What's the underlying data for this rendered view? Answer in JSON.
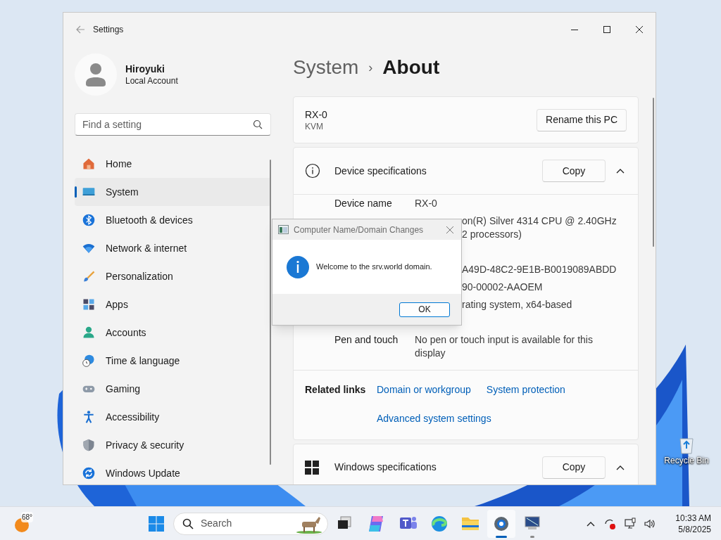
{
  "window": {
    "title": "Settings"
  },
  "profile": {
    "name": "Hiroyuki",
    "account": "Local Account"
  },
  "search": {
    "placeholder": "Find a setting"
  },
  "nav": [
    {
      "label": "Home",
      "selected": false
    },
    {
      "label": "System",
      "selected": true
    },
    {
      "label": "Bluetooth & devices",
      "selected": false
    },
    {
      "label": "Network & internet",
      "selected": false
    },
    {
      "label": "Personalization",
      "selected": false
    },
    {
      "label": "Apps",
      "selected": false
    },
    {
      "label": "Accounts",
      "selected": false
    },
    {
      "label": "Time & language",
      "selected": false
    },
    {
      "label": "Gaming",
      "selected": false
    },
    {
      "label": "Accessibility",
      "selected": false
    },
    {
      "label": "Privacy & security",
      "selected": false
    },
    {
      "label": "Windows Update",
      "selected": false
    }
  ],
  "breadcrumb": {
    "parent": "System",
    "separator": "›",
    "current": "About"
  },
  "pc": {
    "name": "RX-0",
    "model": "KVM",
    "button": "Rename this PC"
  },
  "device_specs": {
    "title": "Device specifications",
    "copy": "Copy",
    "expanded": true,
    "rows": [
      {
        "kind": "full",
        "label": "Device name",
        "lines": [
          "RX-0"
        ]
      },
      {
        "kind": "partly_hidden",
        "lines": [
          "on(R) Silver 4314 CPU @ 2.40GHz",
          "2 processors)"
        ]
      },
      {
        "kind": "hidden"
      },
      {
        "kind": "partly_hidden",
        "lines": [
          "A49D-48C2-9E1B-B0019089ABDD"
        ]
      },
      {
        "kind": "partly_hidden",
        "lines": [
          "90-00002-AAOEM"
        ]
      },
      {
        "kind": "partly_hidden",
        "lines": [
          "rating system, x64-based"
        ]
      },
      {
        "kind": "hidden"
      },
      {
        "kind": "full",
        "label": "Pen and touch",
        "lines": [
          "No pen or touch input is available for this",
          "display"
        ]
      }
    ]
  },
  "related_links": {
    "label": "Related links",
    "links": [
      "Domain or workgroup",
      "System protection",
      "Advanced system settings"
    ]
  },
  "windows_specs": {
    "title": "Windows specifications",
    "copy": "Copy",
    "expanded": true
  },
  "dialog": {
    "title": "Computer Name/Domain Changes",
    "message": "Welcome to the srv.world domain.",
    "button": "OK"
  },
  "desktop_icons": [
    {
      "label": "Recycle Bin"
    }
  ],
  "taskbar": {
    "weather": "68°",
    "search": "Search",
    "time": "10:33 AM",
    "date": "5/8/2025"
  }
}
